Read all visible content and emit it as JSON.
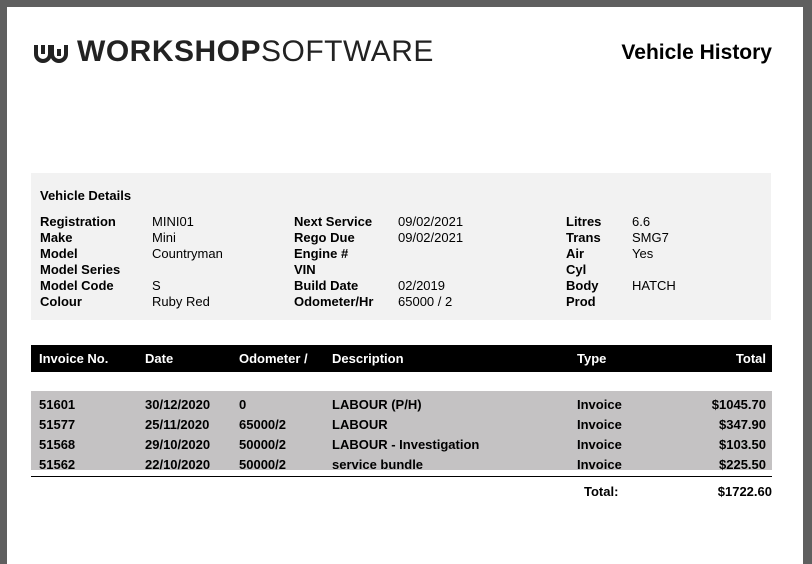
{
  "header": {
    "brand_bold": "WORKSHOP",
    "brand_light": "SOFTWARE",
    "title": "Vehicle History"
  },
  "vehicle_details": {
    "heading": "Vehicle Details",
    "col1": [
      {
        "label": "Registration",
        "value": "MINI01"
      },
      {
        "label": "Make",
        "value": "Mini"
      },
      {
        "label": "Model",
        "value": "Countryman"
      },
      {
        "label": "Model Series",
        "value": ""
      },
      {
        "label": "Model Code",
        "value": "S"
      },
      {
        "label": "Colour",
        "value": "Ruby Red"
      }
    ],
    "col2": [
      {
        "label": "Next Service",
        "value": "09/02/2021"
      },
      {
        "label": "Rego Due",
        "value": "09/02/2021"
      },
      {
        "label": "Engine #",
        "value": ""
      },
      {
        "label": "VIN",
        "value": ""
      },
      {
        "label": "Build Date",
        "value": "02/2019"
      },
      {
        "label": "Odometer/Hr",
        "value": "65000 / 2"
      }
    ],
    "col3": [
      {
        "label": "Litres",
        "value": "6.6"
      },
      {
        "label": "Trans",
        "value": "SMG7"
      },
      {
        "label": "Air",
        "value": "Yes"
      },
      {
        "label": "Cyl",
        "value": ""
      },
      {
        "label": "Body",
        "value": "HATCH"
      },
      {
        "label": "Prod",
        "value": ""
      }
    ]
  },
  "invoices": {
    "columns": [
      "Invoice No.",
      "Date",
      "Odometer /",
      "Description",
      "Type",
      "Total"
    ],
    "rows": [
      {
        "no": "51601",
        "date": "30/12/2020",
        "odometer": "0",
        "description": "LABOUR (P/H)",
        "type": "Invoice",
        "total": "$1045.70"
      },
      {
        "no": "51577",
        "date": "25/11/2020",
        "odometer": "65000/2",
        "description": "LABOUR",
        "type": "Invoice",
        "total": "$347.90"
      },
      {
        "no": "51568",
        "date": "29/10/2020",
        "odometer": "50000/2",
        "description": "LABOUR - Investigation",
        "type": "Invoice",
        "total": "$103.50"
      },
      {
        "no": "51562",
        "date": "22/10/2020",
        "odometer": "50000/2",
        "description": "service bundle",
        "type": "Invoice",
        "total": "$225.50"
      }
    ],
    "total_label": "Total:",
    "total_value": "$1722.60"
  }
}
